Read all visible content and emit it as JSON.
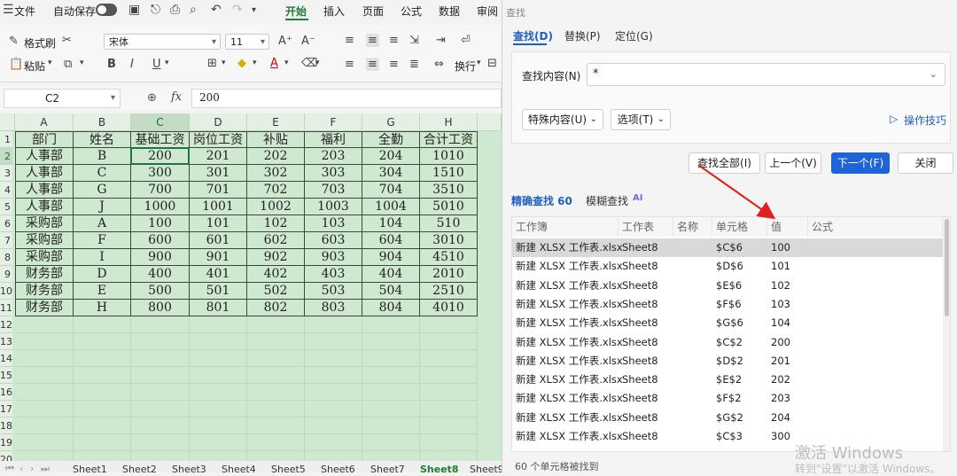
{
  "menu": {
    "file": "文件",
    "autosave": "自动保存",
    "tabs": [
      "开始",
      "插入",
      "页面",
      "公式",
      "数据",
      "审阅"
    ]
  },
  "ribbon": {
    "format_painter": "格式刷",
    "paste": "粘贴",
    "font_name": "宋体",
    "font_size": "11",
    "wrap_text": "换行"
  },
  "formula_bar": {
    "cell_ref": "C2",
    "fx": "fx",
    "content": "200"
  },
  "sheet": {
    "columns": [
      "A",
      "B",
      "C",
      "D",
      "E",
      "F",
      "G",
      "H"
    ],
    "row_numbers": [
      "1",
      "2",
      "3",
      "4",
      "5",
      "6",
      "7",
      "8",
      "9",
      "10",
      "11",
      "12",
      "13",
      "14",
      "15",
      "16",
      "17",
      "18",
      "19",
      "20"
    ],
    "header": [
      "部门",
      "姓名",
      "基础工资",
      "岗位工资",
      "补贴",
      "福利",
      "全勤",
      "合计工资"
    ],
    "rows": [
      [
        "人事部",
        "B",
        "200",
        "201",
        "202",
        "203",
        "204",
        "1010"
      ],
      [
        "人事部",
        "C",
        "300",
        "301",
        "302",
        "303",
        "304",
        "1510"
      ],
      [
        "人事部",
        "G",
        "700",
        "701",
        "702",
        "703",
        "704",
        "3510"
      ],
      [
        "人事部",
        "J",
        "1000",
        "1001",
        "1002",
        "1003",
        "1004",
        "5010"
      ],
      [
        "采购部",
        "A",
        "100",
        "101",
        "102",
        "103",
        "104",
        "510"
      ],
      [
        "采购部",
        "F",
        "600",
        "601",
        "602",
        "603",
        "604",
        "3010"
      ],
      [
        "采购部",
        "I",
        "900",
        "901",
        "902",
        "903",
        "904",
        "4510"
      ],
      [
        "财务部",
        "D",
        "400",
        "401",
        "402",
        "403",
        "404",
        "2010"
      ],
      [
        "财务部",
        "E",
        "500",
        "501",
        "502",
        "503",
        "504",
        "2510"
      ],
      [
        "财务部",
        "H",
        "800",
        "801",
        "802",
        "803",
        "804",
        "4010"
      ]
    ]
  },
  "sheet_tabs": [
    "Sheet1",
    "Sheet2",
    "Sheet3",
    "Sheet4",
    "Sheet5",
    "Sheet6",
    "Sheet7",
    "Sheet8",
    "Sheet9"
  ],
  "active_sheet": "Sheet8",
  "find_dialog": {
    "title": "查找",
    "tabs": [
      "查找(D)",
      "替换(P)",
      "定位(G)"
    ],
    "find_label": "查找内容(N)",
    "find_value": "*",
    "special_btn": "特殊内容(U)",
    "options_btn": "选项(T)",
    "tips_link": "操作技巧",
    "find_all_btn": "查找全部(I)",
    "prev_btn": "上一个(V)",
    "next_btn": "下一个(F)",
    "close_btn": "关闭",
    "exact_tab": "精确查找 60",
    "fuzzy_tab": "模糊查找",
    "ai_badge": "AI",
    "result_headers": [
      "工作簿",
      "工作表",
      "名称",
      "单元格",
      "值",
      "公式"
    ],
    "results": [
      [
        "新建 XLSX 工作表.xlsx",
        "Sheet8",
        "$C$6",
        "100"
      ],
      [
        "新建 XLSX 工作表.xlsx",
        "Sheet8",
        "$D$6",
        "101"
      ],
      [
        "新建 XLSX 工作表.xlsx",
        "Sheet8",
        "$E$6",
        "102"
      ],
      [
        "新建 XLSX 工作表.xlsx",
        "Sheet8",
        "$F$6",
        "103"
      ],
      [
        "新建 XLSX 工作表.xlsx",
        "Sheet8",
        "$G$6",
        "104"
      ],
      [
        "新建 XLSX 工作表.xlsx",
        "Sheet8",
        "$C$2",
        "200"
      ],
      [
        "新建 XLSX 工作表.xlsx",
        "Sheet8",
        "$D$2",
        "201"
      ],
      [
        "新建 XLSX 工作表.xlsx",
        "Sheet8",
        "$E$2",
        "202"
      ],
      [
        "新建 XLSX 工作表.xlsx",
        "Sheet8",
        "$F$2",
        "203"
      ],
      [
        "新建 XLSX 工作表.xlsx",
        "Sheet8",
        "$G$2",
        "204"
      ],
      [
        "新建 XLSX 工作表.xlsx",
        "Sheet8",
        "$C$3",
        "300"
      ]
    ],
    "status": "60 个单元格被找到"
  },
  "watermark": {
    "line1": "激活 Windows",
    "line2": "转到\"设置\"以激活 Windows。"
  },
  "colors": {
    "accent_green": "#1e7e34",
    "grid_fill": "#cfe8d0",
    "dialog_blue": "#1f64d6",
    "arrow_red": "#e02020"
  }
}
